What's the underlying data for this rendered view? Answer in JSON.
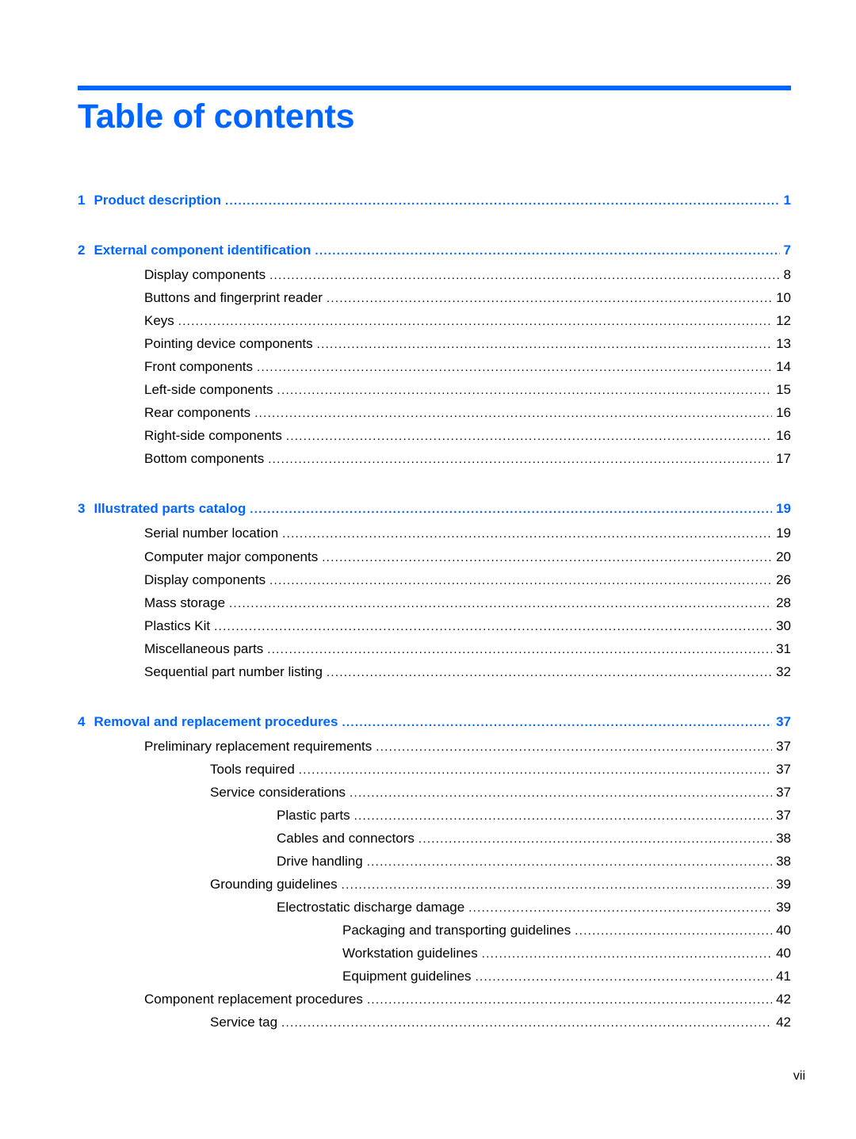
{
  "page": {
    "title": "Table of contents",
    "folio": "vii",
    "accent_color": "#0066ff"
  },
  "toc": [
    {
      "level": 0,
      "num": "1",
      "label": "Product description",
      "page": "1"
    },
    {
      "level": 0,
      "num": "2",
      "label": "External component identification",
      "page": "7"
    },
    {
      "level": 1,
      "label": "Display components",
      "page": "8"
    },
    {
      "level": 1,
      "label": "Buttons and fingerprint reader",
      "page": "10"
    },
    {
      "level": 1,
      "label": "Keys",
      "page": "12"
    },
    {
      "level": 1,
      "label": "Pointing device components",
      "page": "13"
    },
    {
      "level": 1,
      "label": "Front components",
      "page": "14"
    },
    {
      "level": 1,
      "label": "Left-side components",
      "page": "15"
    },
    {
      "level": 1,
      "label": "Rear components",
      "page": "16"
    },
    {
      "level": 1,
      "label": "Right-side components",
      "page": "16"
    },
    {
      "level": 1,
      "label": "Bottom components",
      "page": "17"
    },
    {
      "level": 0,
      "num": "3",
      "label": "Illustrated parts catalog",
      "page": "19"
    },
    {
      "level": 1,
      "label": "Serial number location",
      "page": "19"
    },
    {
      "level": 1,
      "label": "Computer major components",
      "page": "20"
    },
    {
      "level": 1,
      "label": "Display components",
      "page": "26"
    },
    {
      "level": 1,
      "label": "Mass storage",
      "page": "28"
    },
    {
      "level": 1,
      "label": "Plastics Kit",
      "page": "30"
    },
    {
      "level": 1,
      "label": "Miscellaneous parts",
      "page": "31"
    },
    {
      "level": 1,
      "label": "Sequential part number listing",
      "page": "32"
    },
    {
      "level": 0,
      "num": "4",
      "label": "Removal and replacement procedures",
      "page": "37"
    },
    {
      "level": 1,
      "label": "Preliminary replacement requirements",
      "page": "37"
    },
    {
      "level": 2,
      "label": "Tools required",
      "page": "37"
    },
    {
      "level": 2,
      "label": "Service considerations",
      "page": "37"
    },
    {
      "level": 3,
      "label": "Plastic parts",
      "page": "37"
    },
    {
      "level": 3,
      "label": "Cables and connectors",
      "page": "38"
    },
    {
      "level": 3,
      "label": "Drive handling",
      "page": "38"
    },
    {
      "level": 2,
      "label": "Grounding guidelines",
      "page": "39"
    },
    {
      "level": 3,
      "label": "Electrostatic discharge damage",
      "page": "39"
    },
    {
      "level": 4,
      "label": "Packaging and transporting guidelines",
      "page": "40"
    },
    {
      "level": 4,
      "label": "Workstation guidelines",
      "page": "40"
    },
    {
      "level": 4,
      "label": "Equipment guidelines",
      "page": "41"
    },
    {
      "level": 1,
      "label": "Component replacement procedures",
      "page": "42"
    },
    {
      "level": 2,
      "label": "Service tag",
      "page": "42"
    }
  ]
}
